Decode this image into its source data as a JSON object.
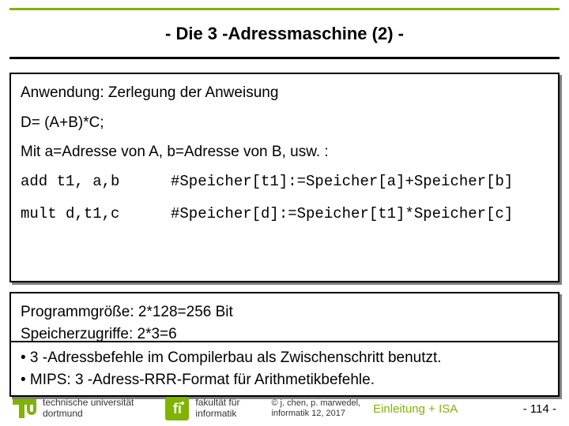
{
  "title": "- Die 3 -Adressmaschine (2) -",
  "box1": {
    "line1": "Anwendung: Zerlegung der Anweisung",
    "line2": "D= (A+B)*C;",
    "line3": "Mit a=Adresse von A, b=Adresse von B, usw. :",
    "code1_left": "add t1, a,b",
    "code1_right": "#Speicher[t1]:=Speicher[a]+Speicher[b]",
    "code2_left": "mult d,t1,c",
    "code2_right": "#Speicher[d]:=Speicher[t1]*Speicher[c]"
  },
  "box2": {
    "line1": "Programmgröße: 2*128=256 Bit",
    "line2": "Speicherzugriffe: 2*3=6"
  },
  "box3": {
    "bullet1": "• 3 -Adressbefehle im Compilerbau als Zwischenschritt benutzt.",
    "bullet2": "• MIPS: 3 -Adress-RRR-Format für Arithmetikbefehle."
  },
  "footer": {
    "uni1": "technische universität",
    "uni2": "dortmund",
    "fak1": "fakultät für",
    "fak2": "informatik",
    "copy1": "© j. chen, p. marwedel,",
    "copy2": "informatik 12,  2017",
    "section": "Einleitung + ISA",
    "page": "-  114 -",
    "fi_glyph": "fi"
  }
}
